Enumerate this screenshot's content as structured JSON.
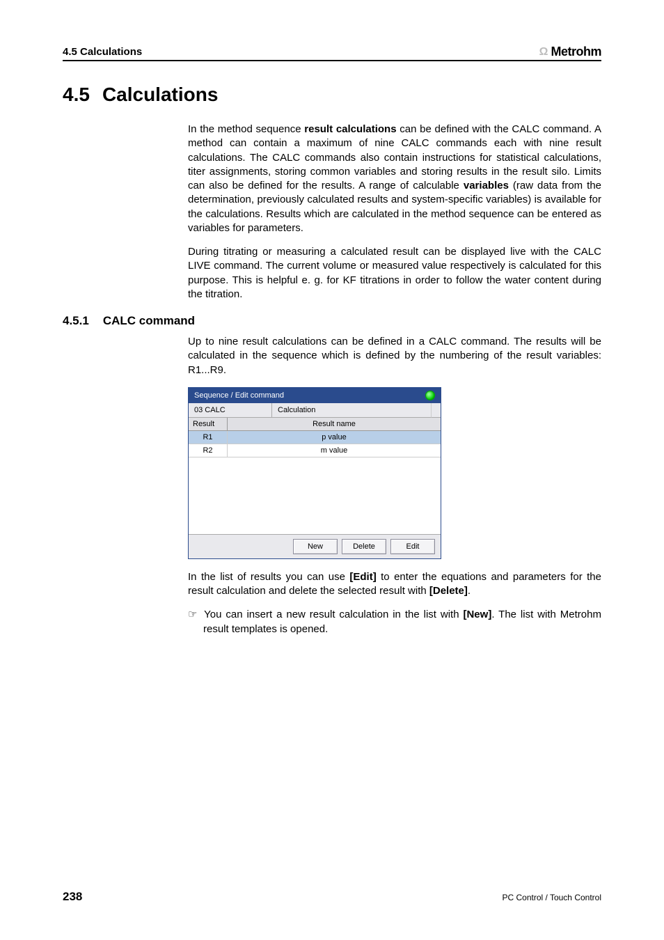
{
  "header": {
    "left": "4.5 Calculations",
    "brand_symbol": "Ω",
    "brand_text": "Metrohm"
  },
  "section": {
    "number": "4.5",
    "title": "Calculations",
    "para1_a": "In the method sequence ",
    "para1_b_bold": "result calculations",
    "para1_c": " can be defined with the CALC command. A method can contain a maximum of nine CALC commands each with nine result calculations. The CALC commands also contain instructions for statistical calculations, titer assignments, storing common variables and storing results in the result silo. Limits can also be defined for the results. A range of calculable ",
    "para1_d_bold": "variables",
    "para1_e": " (raw data from the determination, previously calculated results and system-specific variables) is available for the calculations. Results which are calculated in the method sequence can be entered as variables for parameters.",
    "para2": "During titrating or measuring a calculated result can be displayed live with the CALC LIVE command. The current volume or measured value respectively is calculated for this purpose. This is helpful e. g. for KF titrations in order to follow the water content during the titration."
  },
  "subsection": {
    "number": "4.5.1",
    "title": "CALC command",
    "para1": "Up to nine result calculations can be defined in a CALC command. The results will be calculated in the sequence which is defined by the numbering of the result variables: R1...R9."
  },
  "panel": {
    "title": "Sequence / Edit command",
    "step_label": "03   CALC",
    "tab_label": "Calculation",
    "col_result": "Result",
    "col_name": "Result name",
    "rows": [
      {
        "id": "R1",
        "name": "p value"
      },
      {
        "id": "R2",
        "name": "m value"
      }
    ],
    "buttons": {
      "new": "New",
      "delete": "Delete",
      "edit": "Edit"
    }
  },
  "after_panel": {
    "para1_a": "In the list of results you can use ",
    "para1_b_bold": "[Edit]",
    "para1_c": " to enter the equations and parameters for the result calculation and delete the selected result with ",
    "para1_d_bold": "[Delete]",
    "para1_e": ".",
    "note_hand": "☞",
    "note_a": " You can insert a new result calculation in the list with ",
    "note_b_bold": "[New]",
    "note_c": ". The list with Metrohm result templates is opened."
  },
  "footer": {
    "page": "238",
    "right": "PC Control / Touch Control"
  }
}
